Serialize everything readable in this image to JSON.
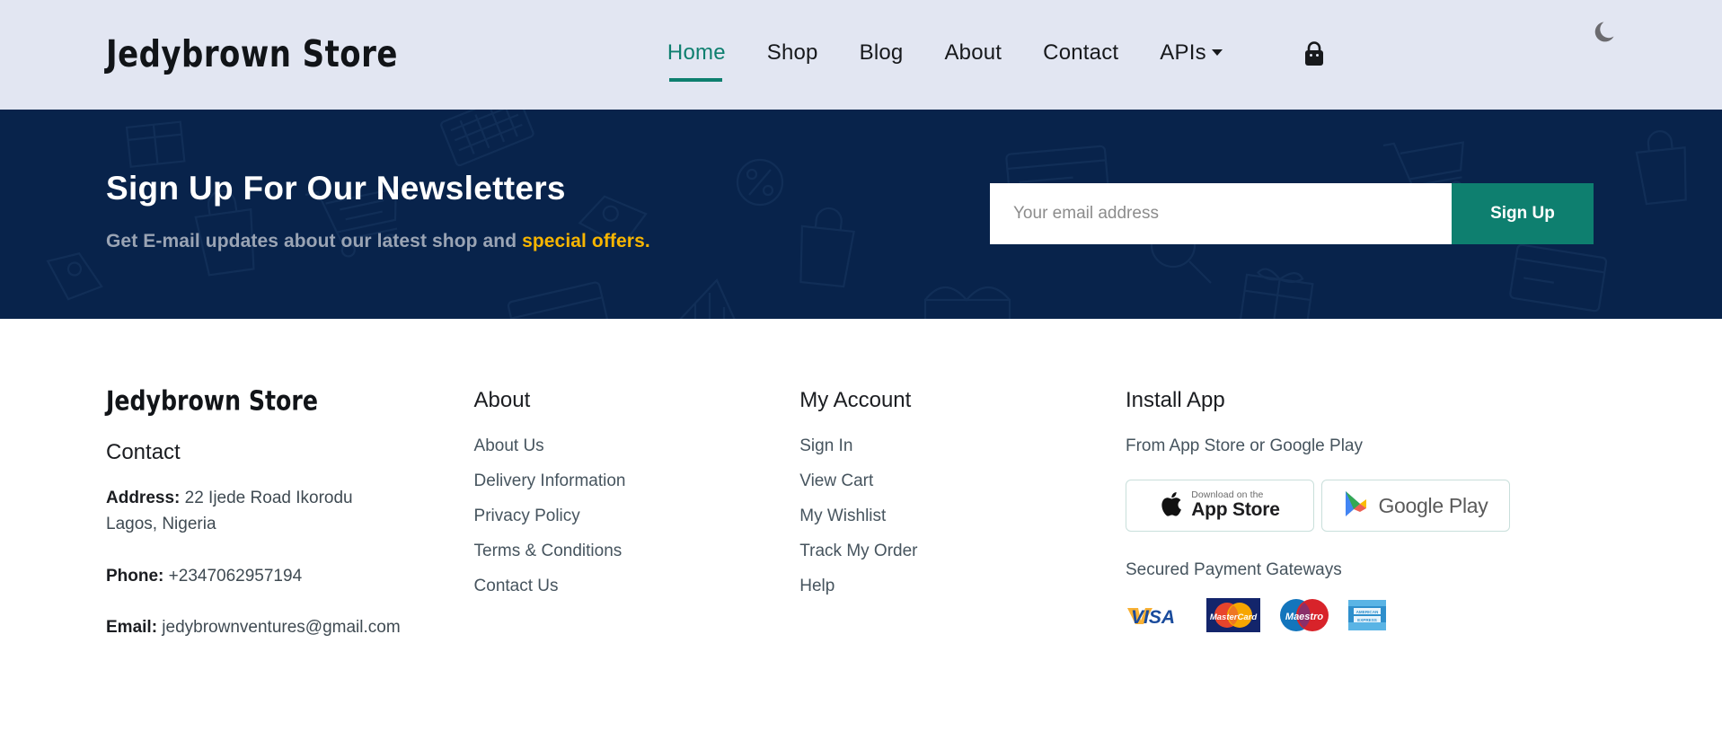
{
  "header": {
    "logo": "Jedybrown Store",
    "nav": [
      {
        "label": "Home",
        "active": true
      },
      {
        "label": "Shop",
        "active": false
      },
      {
        "label": "Blog",
        "active": false
      },
      {
        "label": "About",
        "active": false
      },
      {
        "label": "Contact",
        "active": false
      }
    ],
    "dropdown_label": "APIs",
    "cart_icon": "shopping-bag-icon",
    "theme_icon": "moon-icon",
    "bg_color": "#e2e6f2",
    "accent_color": "#0e7f6f"
  },
  "newsletter": {
    "title": "Sign Up For Our Newsletters",
    "subtitle_plain": "Get E-mail updates about our latest shop and ",
    "subtitle_highlight": "special offers.",
    "email_placeholder": "Your email address",
    "email_value": "",
    "signup_label": "Sign Up",
    "bg_color": "#08234b",
    "highlight_color": "#f7b500",
    "button_color": "#0e7f6f"
  },
  "footer": {
    "brand": {
      "logo": "Jedybrown Store",
      "contact_heading": "Contact",
      "address_label": "Address:",
      "address_value": " 22 Ijede Road Ikorodu Lagos, Nigeria",
      "phone_label": "Phone:",
      "phone_value": " +2347062957194",
      "email_label": "Email:",
      "email_value": " jedybrownventures@gmail.com"
    },
    "about": {
      "title": "About",
      "links": [
        "About Us",
        "Delivery Information",
        "Privacy Policy",
        "Terms & Conditions",
        "Contact Us"
      ]
    },
    "account": {
      "title": "My Account",
      "links": [
        "Sign In",
        "View Cart",
        "My Wishlist",
        "Track My Order",
        "Help"
      ]
    },
    "app": {
      "title": "Install App",
      "subtitle": "From App Store or Google Play",
      "appstore_small": "Download on the",
      "appstore_big": "App Store",
      "googleplay_label": "Google Play",
      "secured_label": "Secured Payment Gateways",
      "payments": [
        "VISA",
        "MasterCard",
        "Maestro",
        "AMERICAN EXPRESS"
      ]
    }
  }
}
